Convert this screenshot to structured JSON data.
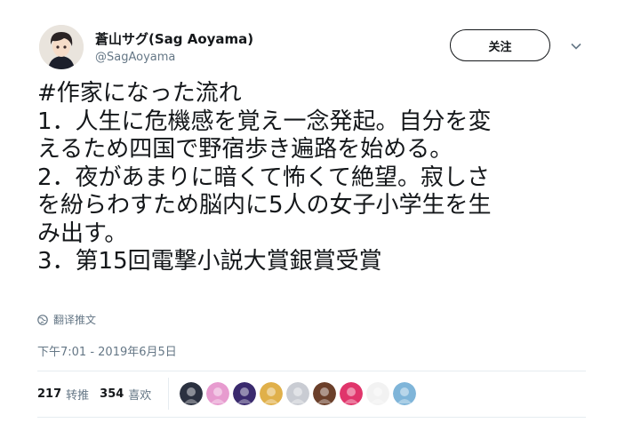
{
  "user": {
    "display_name": "蒼山サグ(Sag Aoyama)",
    "handle": "@SagAoyama",
    "avatar_icon": "anime-boy-avatar-icon"
  },
  "follow_button": {
    "label": "关注"
  },
  "menu_icon": "chevron-down-icon",
  "tweet": {
    "lines": [
      "#作家になった流れ",
      "1．人生に危機感を覚え一念発起。自分を変",
      "えるため四国で野宿歩き遍路を始める。",
      "2．夜があまりに暗くて怖くて絶望。寂しさ",
      "を紛らわすため脳内に5人の女子小学生を生",
      "み出す。",
      "3．第15回電撃小説大賞銀賞受賞"
    ]
  },
  "translate": {
    "label": "翻译推文",
    "icon": "globe-icon"
  },
  "timestamp": "下午7:01 - 2019年6月5日",
  "stats": {
    "retweets_count": "217",
    "retweets_label": "转推",
    "likes_count": "354",
    "likes_label": "喜欢"
  },
  "likers": [
    {
      "icon": "liker-avatar-icon",
      "color": "#2b3140"
    },
    {
      "icon": "liker-avatar-icon",
      "color": "#e79bcf"
    },
    {
      "icon": "liker-avatar-icon",
      "color": "#3a2a6e"
    },
    {
      "icon": "liker-avatar-icon",
      "color": "#e0b04a"
    },
    {
      "icon": "liker-avatar-icon",
      "color": "#c9ccd3"
    },
    {
      "icon": "liker-avatar-icon",
      "color": "#6b3f2a"
    },
    {
      "icon": "liker-avatar-icon",
      "color": "#e0356b"
    },
    {
      "icon": "liker-avatar-icon",
      "color": "#f2f2f2"
    },
    {
      "icon": "liker-avatar-icon",
      "color": "#7fb5d9"
    }
  ]
}
